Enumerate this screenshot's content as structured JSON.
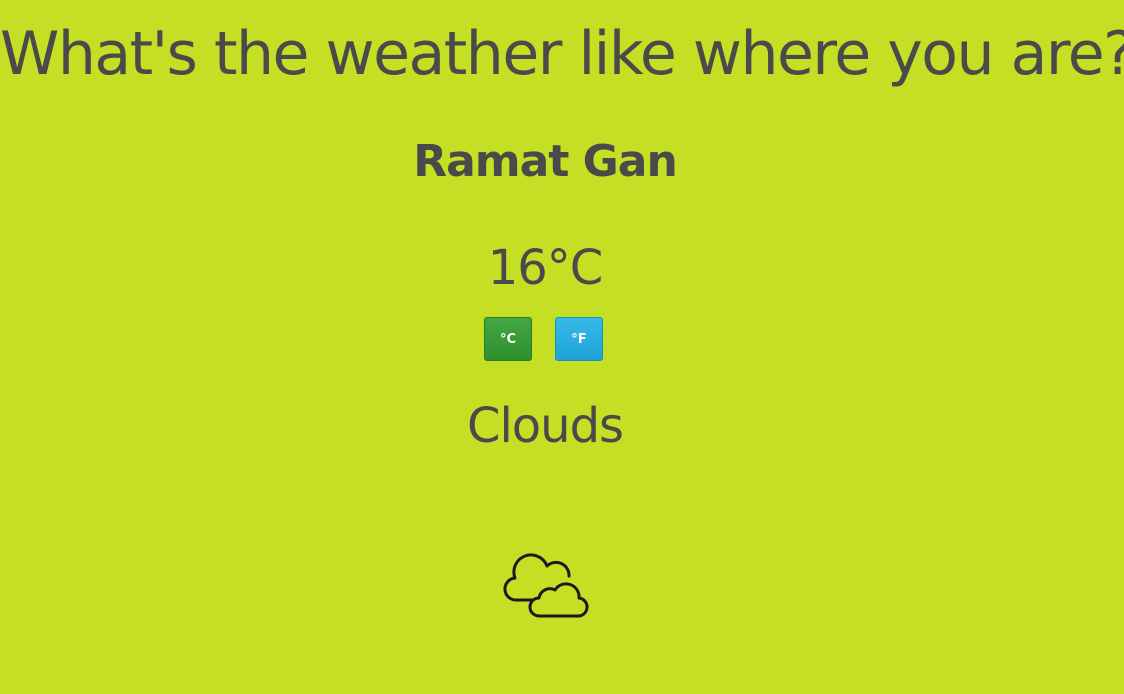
{
  "page": {
    "title": "What's the weather like where you are?"
  },
  "weather": {
    "location": "Ramat Gan",
    "temperature": "16°C",
    "condition": "Clouds",
    "icon": "clouds-icon"
  },
  "units": {
    "celsius_label": "°C",
    "fahrenheit_label": "°F"
  },
  "colors": {
    "background": "#c5e024",
    "text": "#4a4a4a",
    "celsius_button": "#3a9e3a",
    "fahrenheit_button": "#29aee0"
  }
}
